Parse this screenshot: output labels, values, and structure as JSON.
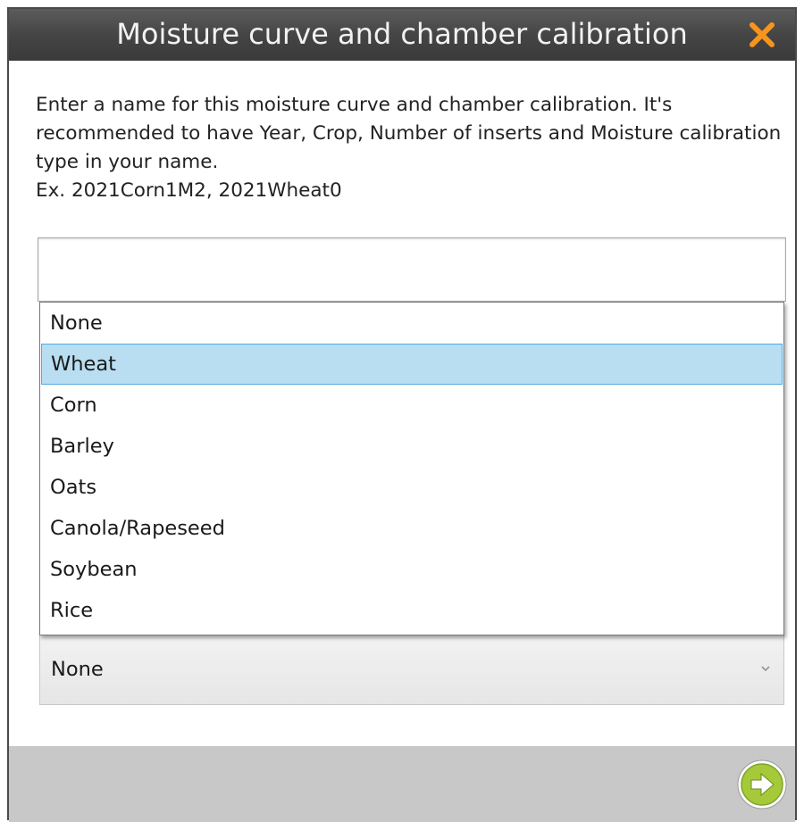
{
  "dialog": {
    "title": "Moisture curve and chamber calibration",
    "close_icon": "close-icon",
    "accent_color": "#f7941d"
  },
  "instructions": {
    "line1": "Enter a name for this moisture curve and chamber calibration. It's recommended to have Year, Crop, Number of inserts and Moisture calibration type in your name.",
    "line2": "Ex. 2021Corn1M2, 2021Wheat0"
  },
  "name_input": {
    "value": "",
    "placeholder": ""
  },
  "crop_dropdown": {
    "options": [
      "None",
      "Wheat",
      "Corn",
      "Barley",
      "Oats",
      "Canola/Rapeseed",
      "Soybean",
      "Rice"
    ],
    "highlighted": "Wheat",
    "selected_value": "None",
    "highlight_color": "#b9def2"
  },
  "footer": {
    "next_icon": "arrow-right-circle-icon",
    "next_color": "#a6c93a"
  }
}
